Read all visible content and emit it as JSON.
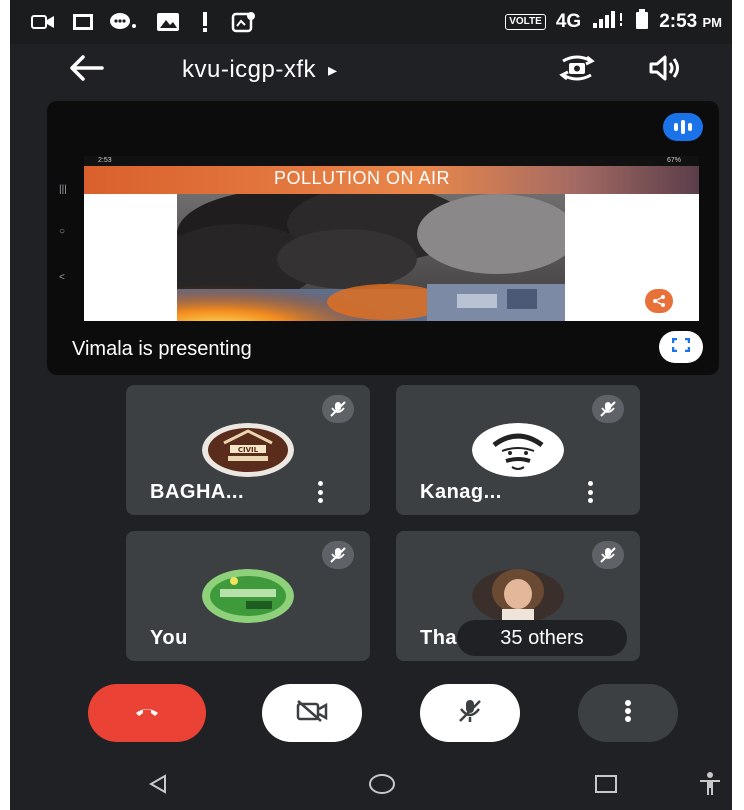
{
  "status_bar": {
    "network_label": "VOLTE",
    "network_type": "4G",
    "time": "2:53",
    "time_suffix": "PM",
    "icons": [
      "video-call-notification-icon",
      "cast-icon",
      "chat-notification-icon",
      "image-notification-icon",
      "alert-icon",
      "location-notification-icon",
      "signal-icon",
      "battery-icon"
    ]
  },
  "app_bar": {
    "meeting_code": "kvu-icgp-xfk",
    "title_arrow": "▸",
    "icons": [
      "back-arrow-icon",
      "switch-camera-icon",
      "speaker-icon"
    ]
  },
  "presentation": {
    "presenter_label": "Vimala is presenting",
    "slide_title": "POLLUTION ON AIR",
    "mini_status_time": "2:53",
    "mini_status_battery": "67%",
    "icons": [
      "speaking-indicator-icon",
      "share-icon",
      "fullscreen-icon"
    ]
  },
  "participants": [
    {
      "name": "BAGHA...",
      "muted": true,
      "avatar_icon": "logo-avatar"
    },
    {
      "name": "Kanag...",
      "muted": true,
      "avatar_icon": "portrait-sketch-avatar"
    },
    {
      "name": "You",
      "muted": true,
      "avatar_icon": "green-logo-avatar"
    },
    {
      "name": "Tha",
      "muted": true,
      "avatar_icon": "photo-avatar"
    }
  ],
  "others_chip": "35 others",
  "controls": {
    "icons": [
      "end-call-icon",
      "camera-off-icon",
      "mic-off-icon",
      "more-options-icon"
    ],
    "colors": {
      "end_call": "#ea4335",
      "toggle_bg": "#ffffff",
      "more_bg": "#3c4043"
    }
  },
  "nav_bar": {
    "icons": [
      "nav-back-icon",
      "nav-home-icon",
      "nav-recents-icon",
      "accessibility-icon"
    ]
  },
  "colors": {
    "background": "#202124",
    "tile": "#3c4043",
    "accent_blue": "#1a73e8",
    "slide_orange": "#d9602c"
  }
}
